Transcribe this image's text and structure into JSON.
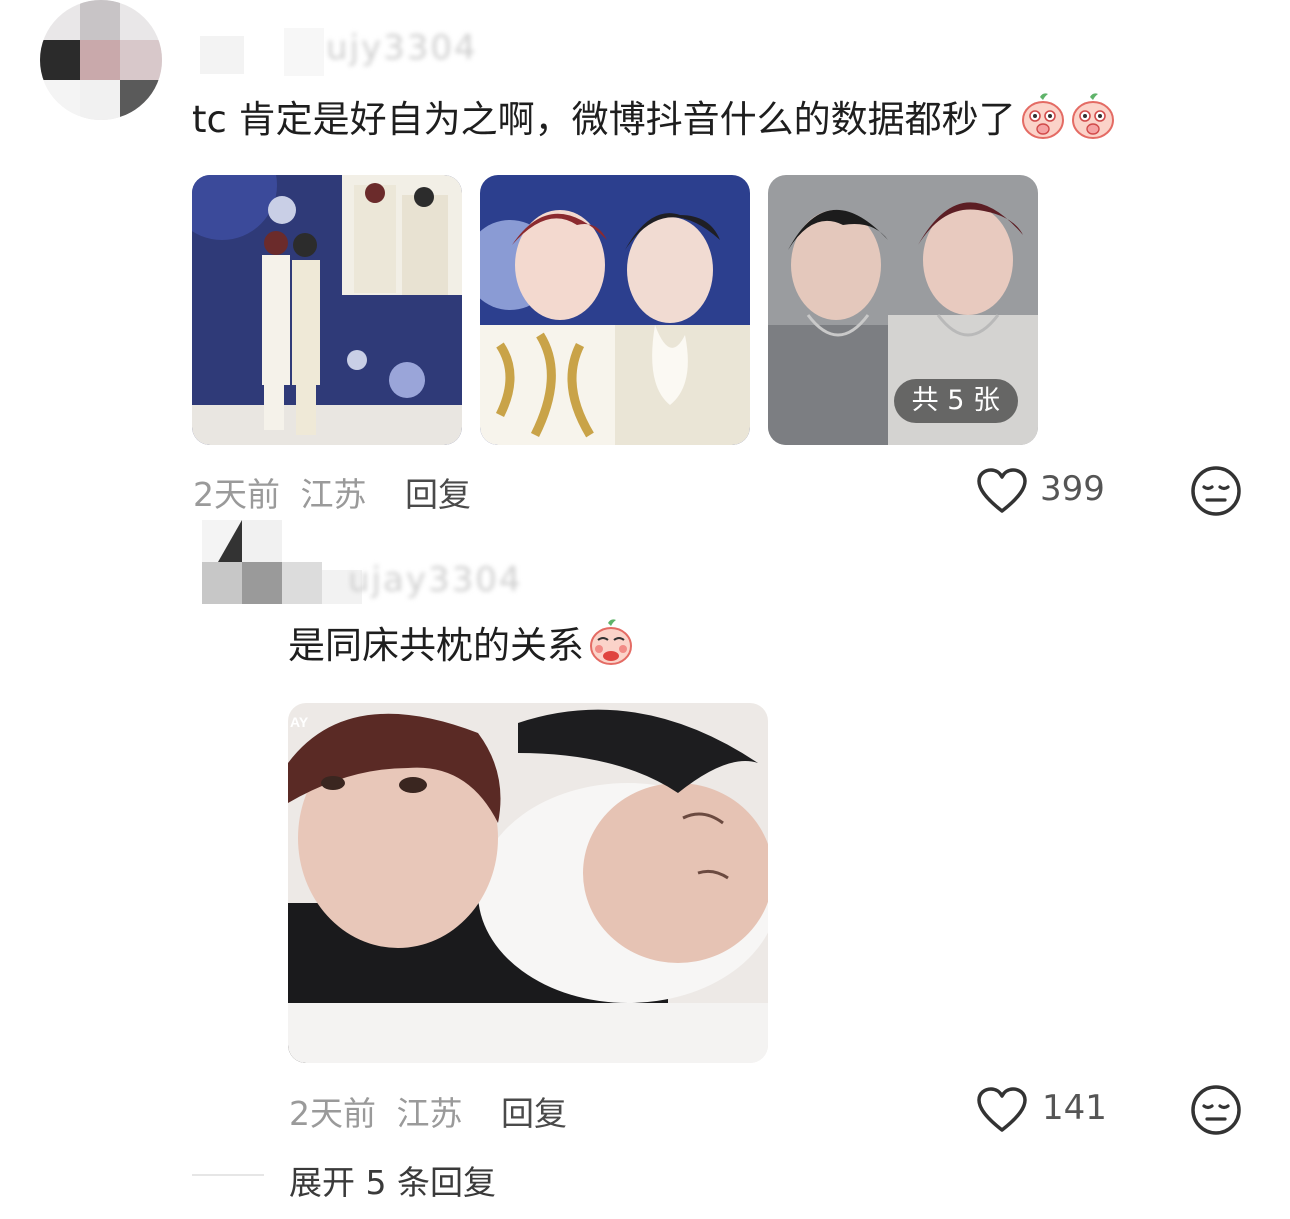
{
  "comments": [
    {
      "username": "ujy3304",
      "text": "tc 肯定是好自为之啊，微博抖音什么的数据都秒了",
      "emoji_icons": [
        "peach-emoji-icon",
        "peach-emoji-icon"
      ],
      "photo_count_label": "共 5 张",
      "time": "2天前",
      "location": "江苏",
      "reply_label": "回复",
      "likes": "399"
    },
    {
      "username": "ujay3304",
      "text": "是同床共枕的关系",
      "emoji_icons": [
        "peach-emoji-icon"
      ],
      "time": "2天前",
      "location": "江苏",
      "reply_label": "回复",
      "likes": "141",
      "expand_label": "展开 5 条回复"
    }
  ],
  "photo_watermark": "AY",
  "colors": {
    "text": "#1e1e1e",
    "meta": "#9a9a9a",
    "icon": "#333333"
  }
}
